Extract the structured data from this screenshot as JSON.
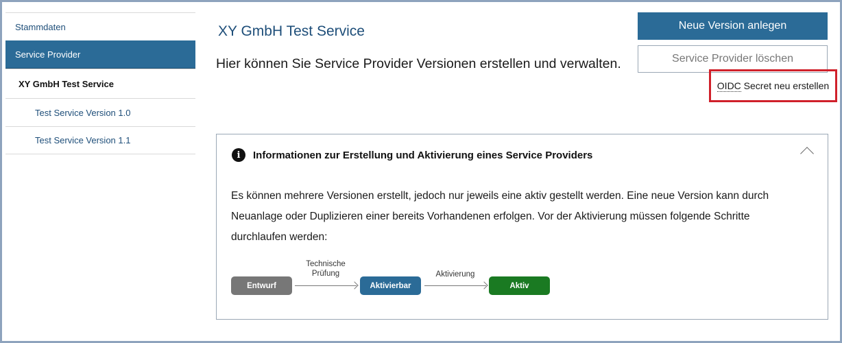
{
  "sidebar": {
    "items": [
      {
        "label": "Stammdaten"
      },
      {
        "label": "Service Provider"
      },
      {
        "label": "XY GmbH Test Service"
      },
      {
        "label": "Test Service Version 1.0"
      },
      {
        "label": "Test Service Version 1.1"
      }
    ]
  },
  "header": {
    "title": "XY GmbH Test Service",
    "subtitle": "Hier können Sie Service Provider Versionen erstellen und verwalten."
  },
  "actions": {
    "new_version_label": "Neue Version anlegen",
    "delete_provider_label": "Service Provider löschen",
    "oidc_abbr": "OIDC",
    "oidc_rest": " Secret neu erstellen"
  },
  "info": {
    "icon": "info-icon",
    "title": "Informationen zur Erstellung und Aktivierung eines Service Providers",
    "text": "Es können mehrere Versionen erstellt, jedoch nur jeweils eine aktiv gestellt werden. Eine neue Version kann durch Neuanlage oder Duplizieren einer bereits Vorhandenen erfolgen. Vor der Aktivierung müssen folgende Schritte durchlaufen werden:",
    "flow": {
      "steps": [
        {
          "label": "Entwurf",
          "color": "#777777"
        },
        {
          "label": "Aktivierbar",
          "color": "#2b6b97"
        },
        {
          "label": "Aktiv",
          "color": "#1a7a22"
        }
      ],
      "transitions": [
        "Technische\nPrüfung",
        "Aktivierung"
      ]
    }
  },
  "colors": {
    "accent": "#2b6b97",
    "highlight_border": "#d0202a"
  }
}
